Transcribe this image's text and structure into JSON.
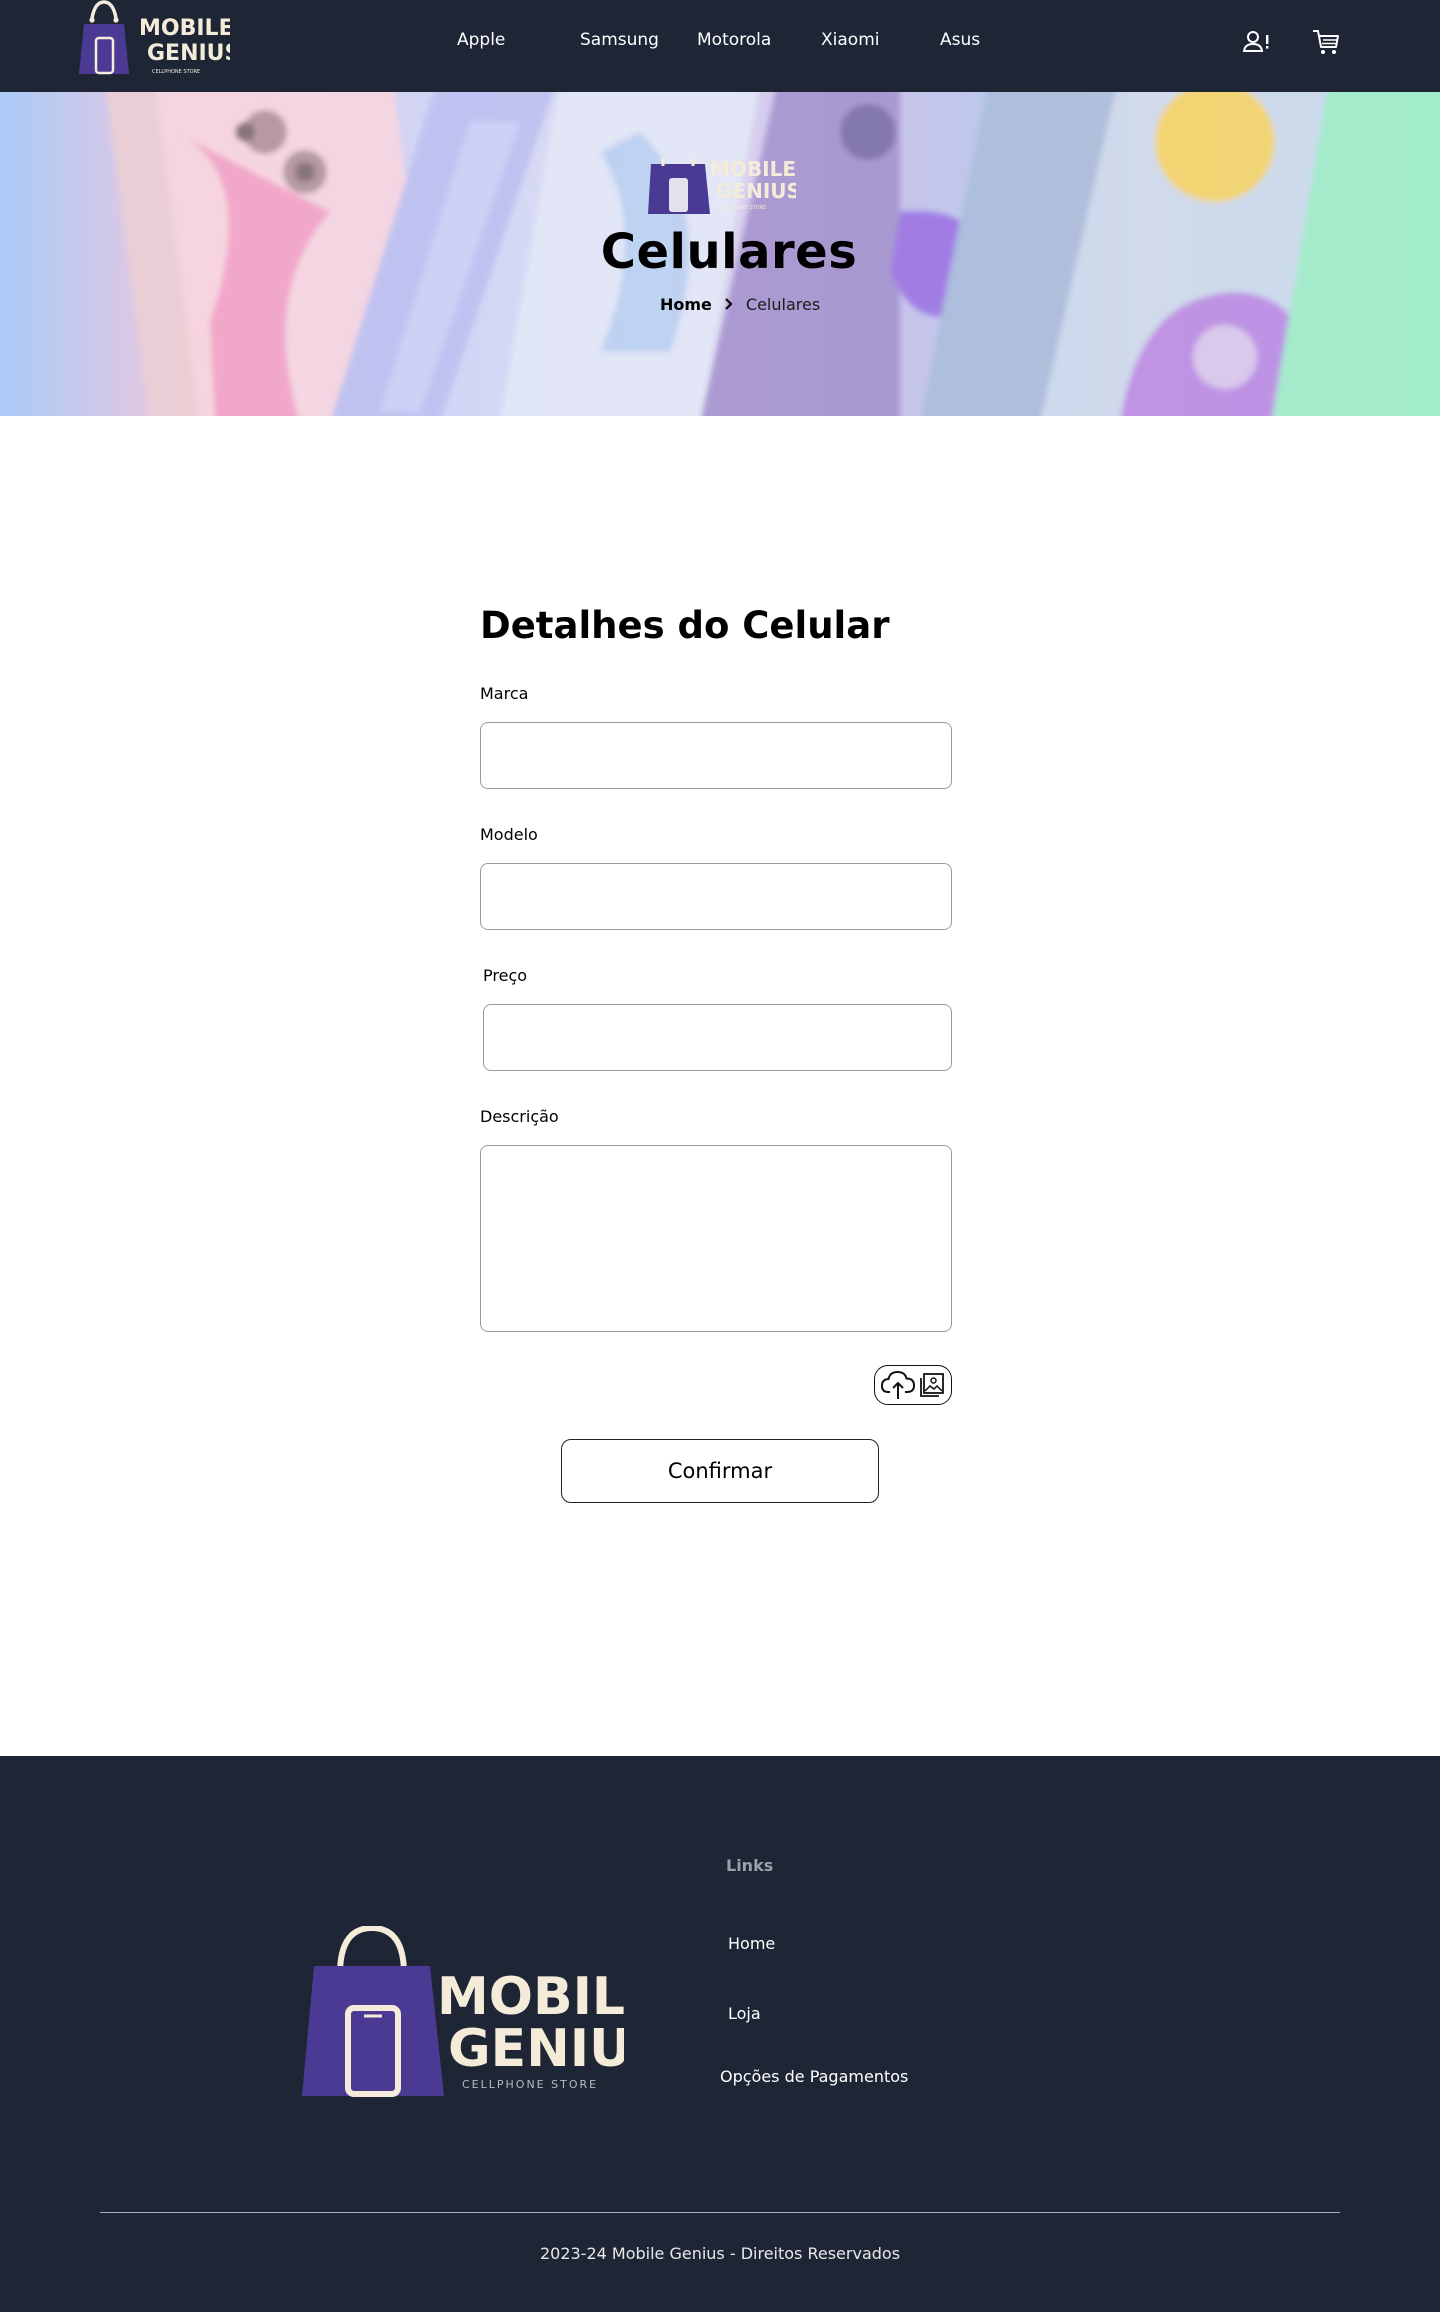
{
  "brand": {
    "name_line1": "MOBILE",
    "name_line2": "GENIUS",
    "tagline": "CELLPHONE STORE",
    "primary_color": "#4b3a93",
    "cream_color": "#f4ecd9",
    "dark_bg": "#1e2636"
  },
  "nav": {
    "links": [
      {
        "label": "Apple"
      },
      {
        "label": "Samsung"
      },
      {
        "label": "Motorola"
      },
      {
        "label": "Xiaomi"
      },
      {
        "label": "Asus"
      }
    ],
    "icons": {
      "account": "user-alert-icon",
      "cart": "shopping-cart-icon"
    }
  },
  "hero": {
    "title": "Celulares",
    "breadcrumb": {
      "home": "Home",
      "current": "Celulares"
    }
  },
  "form": {
    "title": "Detalhes do Celular",
    "fields": {
      "marca": {
        "label": "Marca",
        "value": ""
      },
      "modelo": {
        "label": "Modelo",
        "value": ""
      },
      "preco": {
        "label": "Preço",
        "value": ""
      },
      "descricao": {
        "label": "Descrição",
        "value": ""
      }
    },
    "upload_icons": [
      "cloud-upload-icon",
      "image-icon"
    ],
    "confirm_label": "Confirmar"
  },
  "footer": {
    "links_heading": "Links",
    "links": [
      {
        "label": "Home"
      },
      {
        "label": "Loja"
      },
      {
        "label": "Opções de Pagamentos"
      }
    ],
    "copyright": "2023-24 Mobile Genius - Direitos Reservados"
  }
}
